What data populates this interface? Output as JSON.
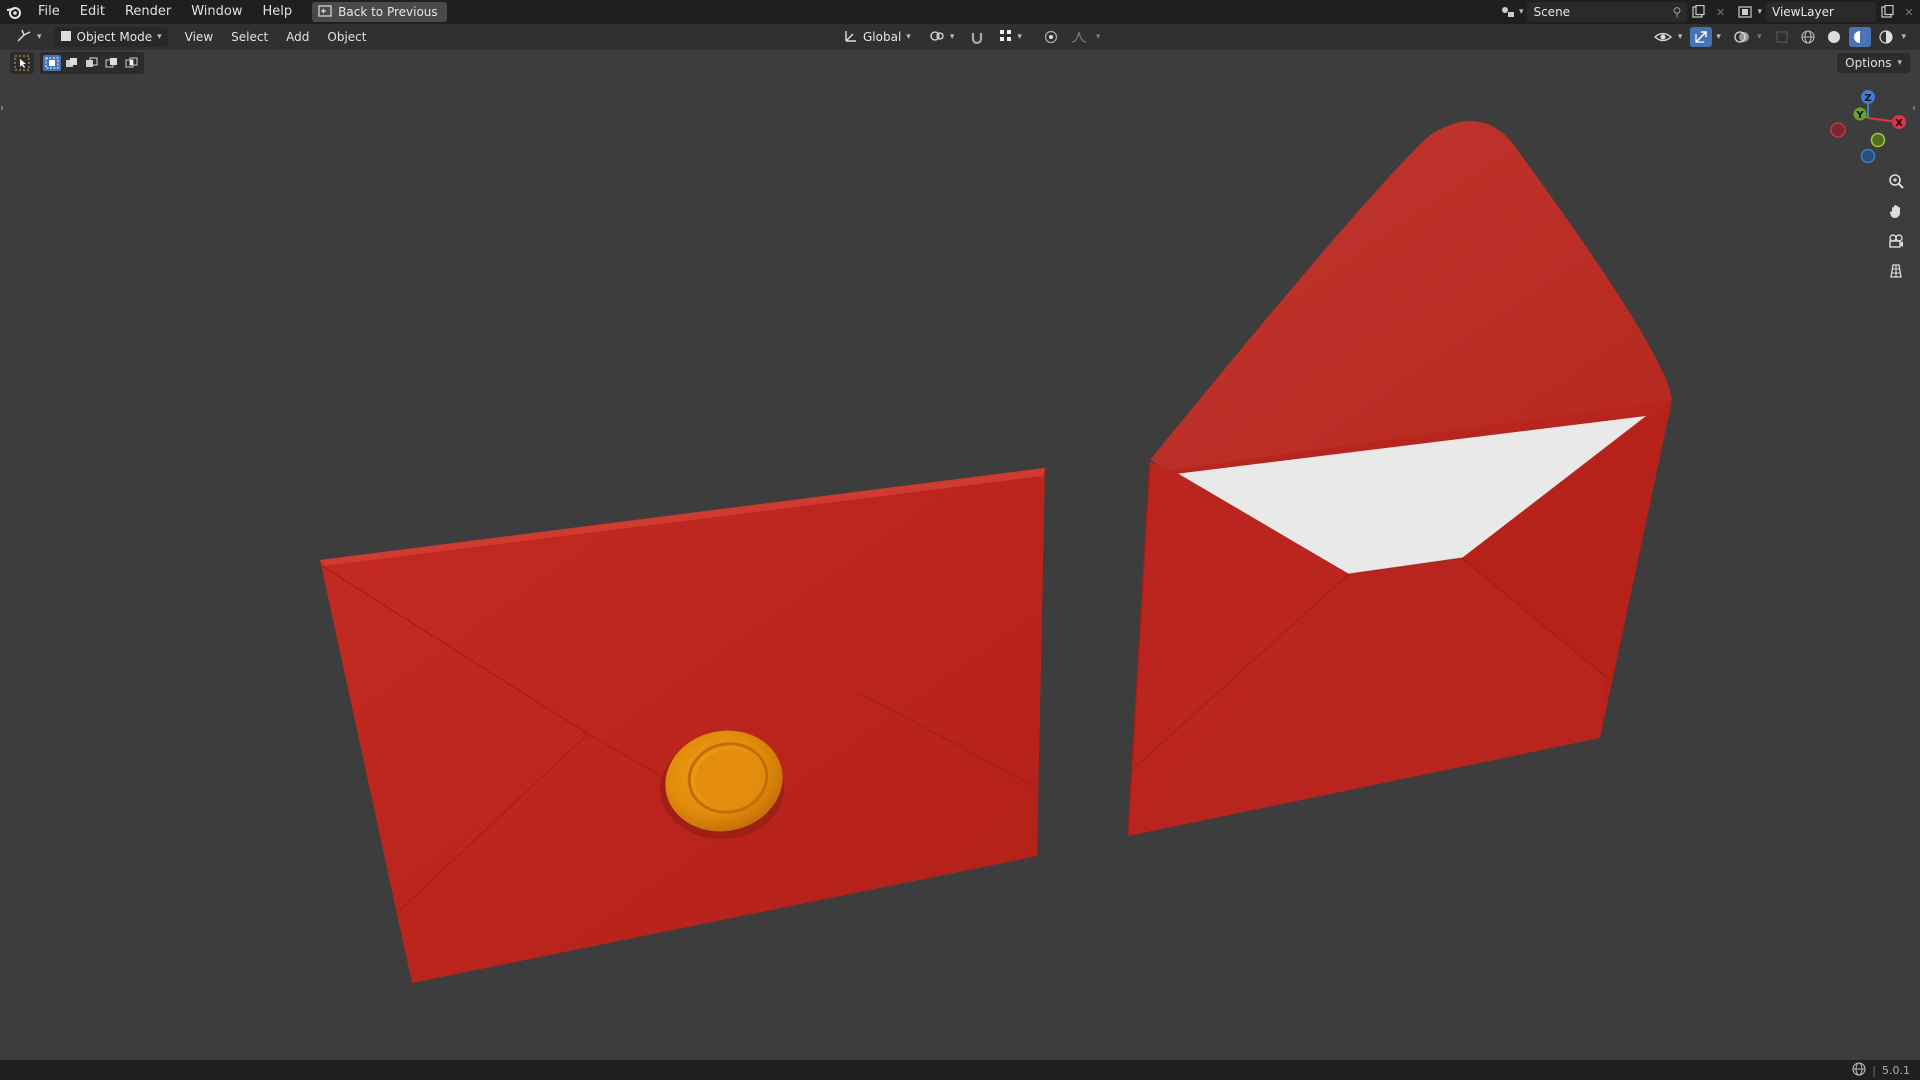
{
  "topbar": {
    "menus": [
      "File",
      "Edit",
      "Render",
      "Window",
      "Help"
    ],
    "back_label": "Back to Previous",
    "scene_label": "Scene",
    "view_layer_label": "ViewLayer"
  },
  "header": {
    "mode_label": "Object Mode",
    "menus": [
      "View",
      "Select",
      "Add",
      "Object"
    ],
    "transform_orientation": "Global"
  },
  "toolbar": {
    "options_label": "Options"
  },
  "gizmo": {
    "z_label": "Z",
    "y_label": "Y",
    "x_label": "X"
  },
  "status": {
    "version": "5.0.1"
  },
  "colors": {
    "envelope_red": "#b8241e",
    "wax_seal": "#e89010",
    "letter_paper": "#e9e9e9",
    "accent": "#4772b3"
  },
  "icons": [
    "blender-logo-icon",
    "back-icon",
    "scene-icon",
    "pin-icon",
    "new-scene-icon",
    "close-icon",
    "view-layer-icon",
    "editor-type-icon",
    "object-mode-icon",
    "orientation-icon",
    "pivot-icon",
    "snap-icon",
    "proportional-icon",
    "falloff-icon",
    "visibility-icon",
    "gizmo-icon",
    "overlay-icon",
    "xray-icon",
    "wireframe-icon",
    "solid-icon",
    "material-preview-icon",
    "rendered-icon",
    "zoom-icon",
    "pan-hand-icon",
    "camera-view-icon",
    "grid-view-icon",
    "select-box-icon",
    "globe-icon"
  ]
}
